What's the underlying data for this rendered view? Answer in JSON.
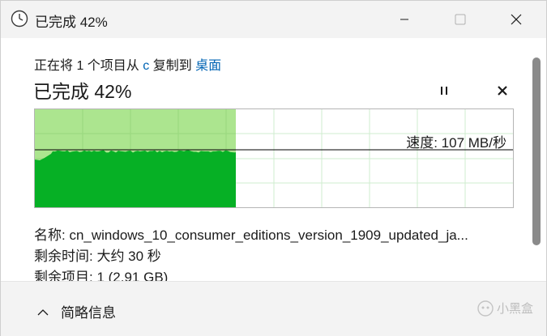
{
  "window": {
    "title": "已完成 42%",
    "icon": "clock-icon"
  },
  "status": {
    "prefix": "正在将 1 个项目从 ",
    "source": "c",
    "middle": " 复制到 ",
    "destination": "桌面",
    "headline": "已完成 42%"
  },
  "controls": {
    "pause_icon": "pause-icon",
    "cancel_icon": "close-icon"
  },
  "graph": {
    "speed_text": "速度: 107 MB/秒",
    "progress_percent": 42,
    "colors": {
      "done_bg": "#ace58f",
      "fill": "#06b025",
      "grid": "#cfeccf",
      "speed_line": "#000000"
    }
  },
  "details": {
    "name": "名称: cn_windows_10_consumer_editions_version_1909_updated_ja...",
    "time_remaining": "剩余时间: 大约 30 秒",
    "items_remaining": "剩余项目: 1 (2.91 GB)"
  },
  "footer": {
    "toggle_label": "简略信息",
    "watermark": "小黑盒"
  }
}
